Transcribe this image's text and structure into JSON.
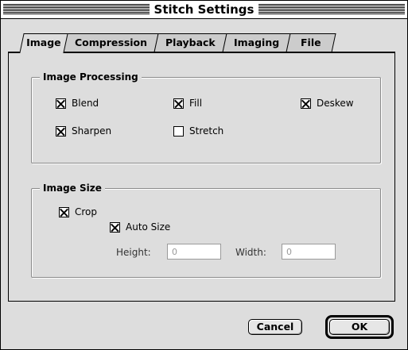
{
  "window": {
    "title": "Stitch Settings"
  },
  "tabs": [
    {
      "label": "Image",
      "active": true
    },
    {
      "label": "Compression",
      "active": false
    },
    {
      "label": "Playback",
      "active": false
    },
    {
      "label": "Imaging",
      "active": false
    },
    {
      "label": "File",
      "active": false
    }
  ],
  "image_processing": {
    "label": "Image Processing",
    "options": [
      {
        "label": "Blend",
        "checked": true
      },
      {
        "label": "Fill",
        "checked": true
      },
      {
        "label": "Deskew",
        "checked": true
      },
      {
        "label": "Sharpen",
        "checked": true
      },
      {
        "label": "Stretch",
        "checked": false
      }
    ]
  },
  "image_size": {
    "label": "Image Size",
    "crop": {
      "label": "Crop",
      "checked": true
    },
    "auto_size": {
      "label": "Auto Size",
      "checked": true
    },
    "height": {
      "label": "Height:",
      "value": "0"
    },
    "width": {
      "label": "Width:",
      "value": "0"
    }
  },
  "buttons": {
    "cancel": "Cancel",
    "ok": "OK"
  }
}
